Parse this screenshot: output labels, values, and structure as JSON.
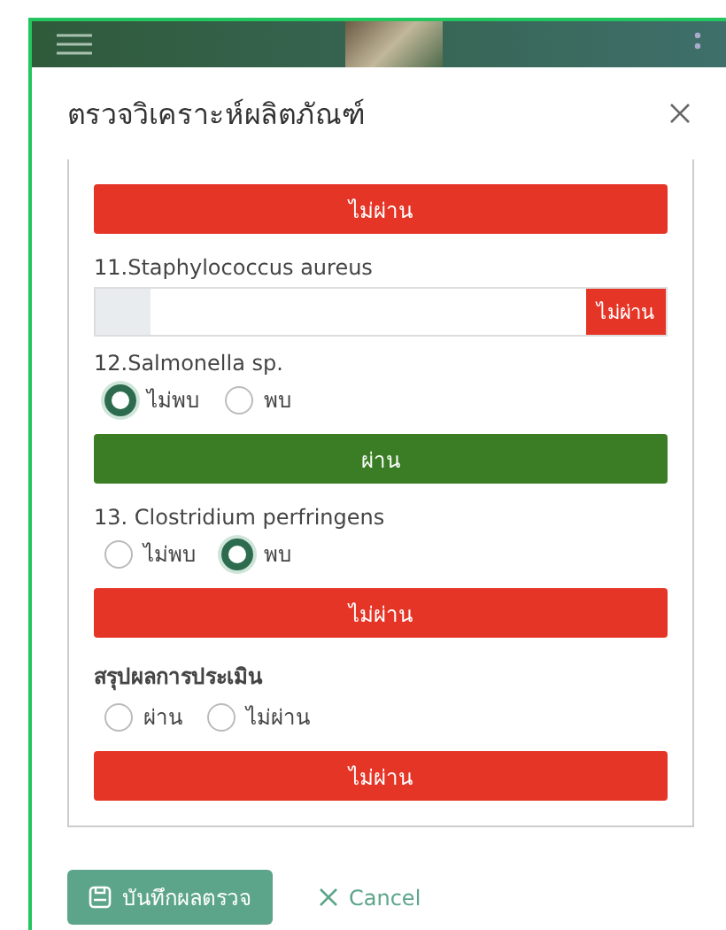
{
  "modal": {
    "title": "ตรวจวิเคราะห์ผลิตภัณฑ์"
  },
  "items": [
    {
      "kind": "result",
      "passed": false,
      "text": "ไม่ผ่าน"
    },
    {
      "kind": "field",
      "label": "11.Staphylococcus aureus",
      "addon": "ไม่ผ่าน",
      "passed": false
    },
    {
      "kind": "radio",
      "label": "12.Salmonella sp.",
      "options": [
        {
          "label": "ไม่พบ",
          "selected": true
        },
        {
          "label": "พบ",
          "selected": false
        }
      ]
    },
    {
      "kind": "result",
      "passed": true,
      "text": "ผ่าน"
    },
    {
      "kind": "radio",
      "label": "13. Clostridium perfringens",
      "options": [
        {
          "label": "ไม่พบ",
          "selected": false
        },
        {
          "label": "พบ",
          "selected": true
        }
      ]
    },
    {
      "kind": "result",
      "passed": false,
      "text": "ไม่ผ่าน"
    },
    {
      "kind": "radio",
      "label": "สรุปผลการประเมิน",
      "bold": true,
      "options": [
        {
          "label": "ผ่าน",
          "selected": false
        },
        {
          "label": "ไม่ผ่าน",
          "selected": false
        }
      ]
    },
    {
      "kind": "result",
      "passed": false,
      "text": "ไม่ผ่าน"
    }
  ],
  "footer": {
    "save": "บันทึกผลตรวจ",
    "cancel": "Cancel"
  }
}
